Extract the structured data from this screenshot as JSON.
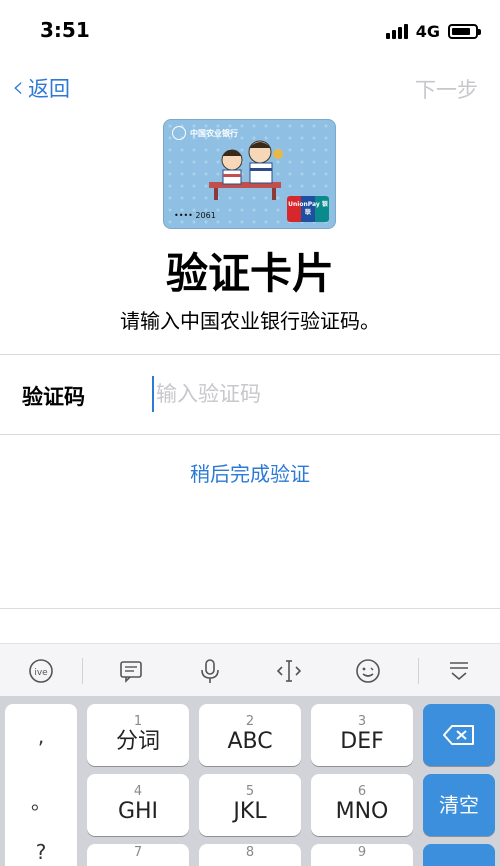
{
  "status": {
    "time": "3:51",
    "network": "4G"
  },
  "nav": {
    "back_label": "返回",
    "next_label": "下一步"
  },
  "card": {
    "bank_name": "中国农业银行",
    "number_masked": "•••• 2061",
    "network_logo": "UnionPay 银联"
  },
  "title": "验证卡片",
  "subtitle": "请输入中国农业银行验证码。",
  "field": {
    "label": "验证码",
    "placeholder": "输入验证码",
    "value": ""
  },
  "later_link": "稍后完成验证",
  "toolbar_icons": [
    "input-method-icon",
    "clipboard-icon",
    "microphone-icon",
    "cursor-move-icon",
    "emoji-icon",
    "hide-keyboard-icon"
  ],
  "keyboard": {
    "punctuation": [
      ",",
      "。",
      "?"
    ],
    "rows": [
      [
        {
          "num": "1",
          "label": "分词"
        },
        {
          "num": "2",
          "label": "ABC"
        },
        {
          "num": "3",
          "label": "DEF"
        }
      ],
      [
        {
          "num": "4",
          "label": "GHI"
        },
        {
          "num": "5",
          "label": "JKL"
        },
        {
          "num": "6",
          "label": "MNO"
        }
      ],
      [
        {
          "num": "7",
          "label": ""
        },
        {
          "num": "8",
          "label": ""
        },
        {
          "num": "9",
          "label": ""
        }
      ]
    ],
    "clear_label": "清空"
  },
  "colors": {
    "accent": "#2d7ad6",
    "key_blue": "#3c8fdc",
    "keyboard_bg": "#d1d3d9"
  }
}
